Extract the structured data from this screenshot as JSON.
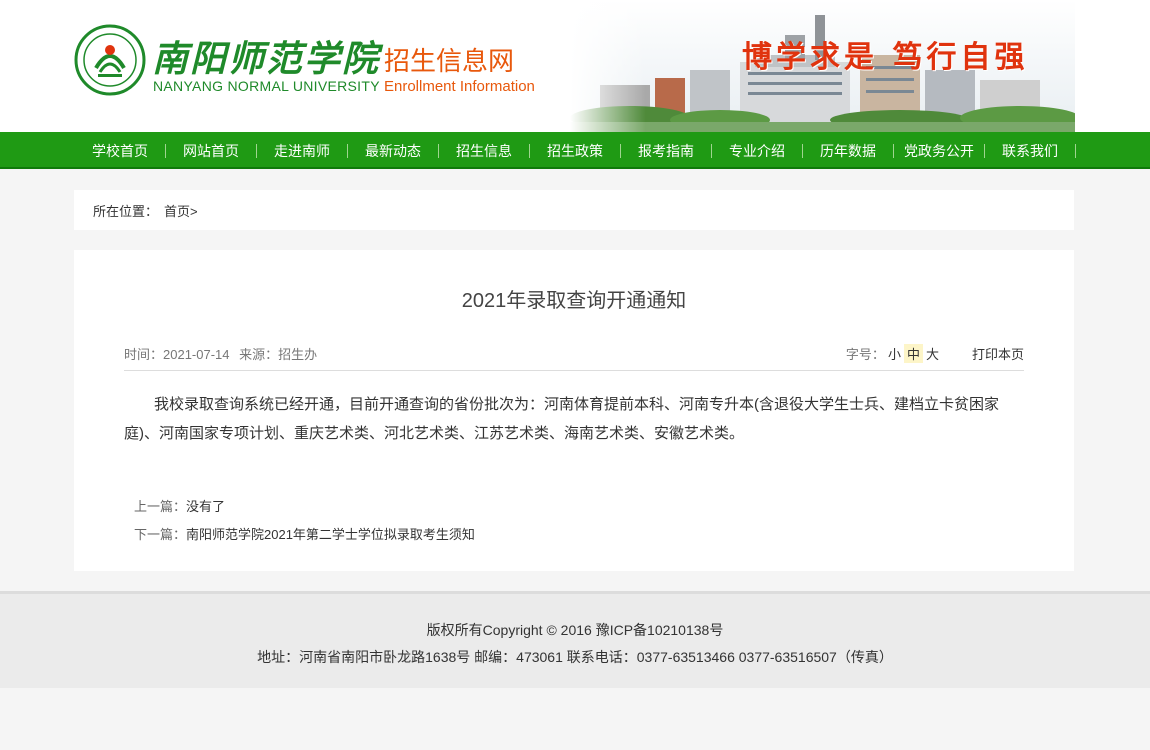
{
  "header": {
    "logo_cn": "南阳师范学院",
    "logo_en": "NANYANG NORMAL UNIVERSITY",
    "site_name_cn": "招生信息网",
    "site_name_en": "Enrollment Information",
    "motto": "博学求是 笃行自强",
    "brand_green": "#1f8a2a",
    "accent_orange": "#e8580c"
  },
  "nav": {
    "items": [
      {
        "label": "学校首页"
      },
      {
        "label": "网站首页"
      },
      {
        "label": "走进南师"
      },
      {
        "label": "最新动态"
      },
      {
        "label": "招生信息"
      },
      {
        "label": "招生政策"
      },
      {
        "label": "报考指南"
      },
      {
        "label": "专业介绍"
      },
      {
        "label": "历年数据"
      },
      {
        "label": "党政务公开"
      },
      {
        "label": "联系我们"
      }
    ],
    "bg_color": "#1f9a14"
  },
  "breadcrumb": {
    "label": "所在位置：",
    "home": "首页>"
  },
  "article": {
    "title": "2021年录取查询开通通知",
    "time": "时间：2021-07-14",
    "source": "来源：招生办",
    "font_size_label": "字号：",
    "font_small": "小",
    "font_medium": "中",
    "font_large": "大",
    "print": "打印本页",
    "body": "我校录取查询系统已经开通，目前开通查询的省份批次为：河南体育提前本科、河南专升本(含退役大学生士兵、建档立卡贫困家庭)、河南国家专项计划、重庆艺术类、河北艺术类、江苏艺术类、海南艺术类、安徽艺术类。",
    "prev_label": "上一篇：",
    "prev_title": "没有了",
    "next_label": "下一篇：",
    "next_title": "南阳师范学院2021年第二学士学位拟录取考生须知"
  },
  "footer": {
    "line1": "版权所有Copyright © 2016 豫ICP备10210138号",
    "line2": "地址：河南省南阳市卧龙路1638号 邮编：473061 联系电话：0377-63513466 0377-63516507（传真）"
  }
}
